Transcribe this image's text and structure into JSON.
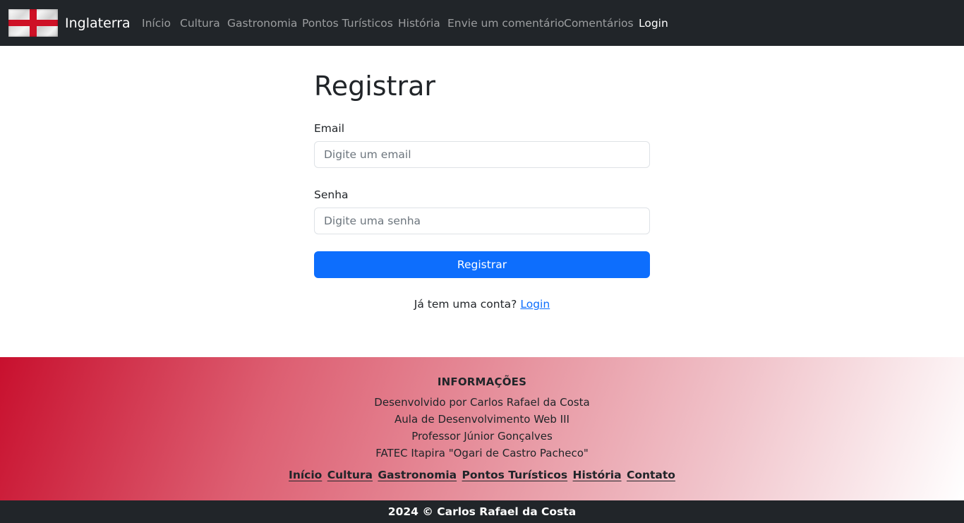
{
  "navbar": {
    "brand": "Inglaterra",
    "links": [
      {
        "label": "Início"
      },
      {
        "label": "Cultura"
      },
      {
        "label": "Gastronomia"
      },
      {
        "label": "Pontos Turísticos"
      },
      {
        "label": "História"
      },
      {
        "label": "Envie um comentário"
      },
      {
        "label": "Comentários"
      },
      {
        "label": "Login"
      }
    ]
  },
  "form": {
    "title": "Registrar",
    "email_label": "Email",
    "email_placeholder": "Digite um email",
    "password_label": "Senha",
    "password_placeholder": "Digite uma senha",
    "submit_label": "Registrar",
    "have_account_text": "Já tem uma conta?",
    "login_link": "Login"
  },
  "footer": {
    "title": "INFORMAÇÕES",
    "lines": [
      "Desenvolvido por Carlos Rafael da Costa",
      "Aula de Desenvolvimento Web III",
      "Professor Júnior Gonçalves",
      "FATEC Itapira \"Ogari de Castro Pacheco\""
    ],
    "links": [
      "Início",
      "Cultura",
      "Gastronomia",
      "Pontos Turísticos",
      "História",
      "Contato"
    ],
    "copyright": "2024 © Carlos Rafael da Costa"
  },
  "colors": {
    "navbar_bg": "#212529",
    "primary": "#0d6efd",
    "footer_gradient_start": "#c8102e"
  },
  "icons": {
    "brand_logo": "england-flag-icon"
  }
}
